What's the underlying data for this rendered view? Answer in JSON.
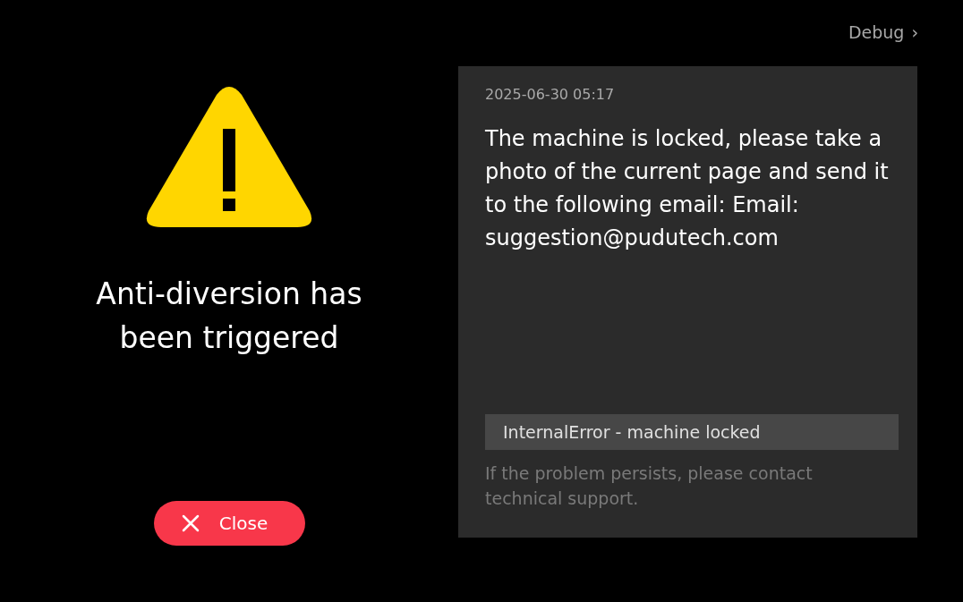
{
  "debug_link": {
    "label": "Debug",
    "icon": "›"
  },
  "alert": {
    "title": "Anti-diversion has been triggered"
  },
  "close_button": {
    "label": "Close"
  },
  "panel": {
    "timestamp": "2025-06-30 05:17",
    "message": "The machine is locked, please take a photo of the current page and send it to the following email: Email: suggestion@pudutech.com",
    "error": "InternalError - machine locked",
    "hint": "If the problem persists, please contact technical support."
  }
}
